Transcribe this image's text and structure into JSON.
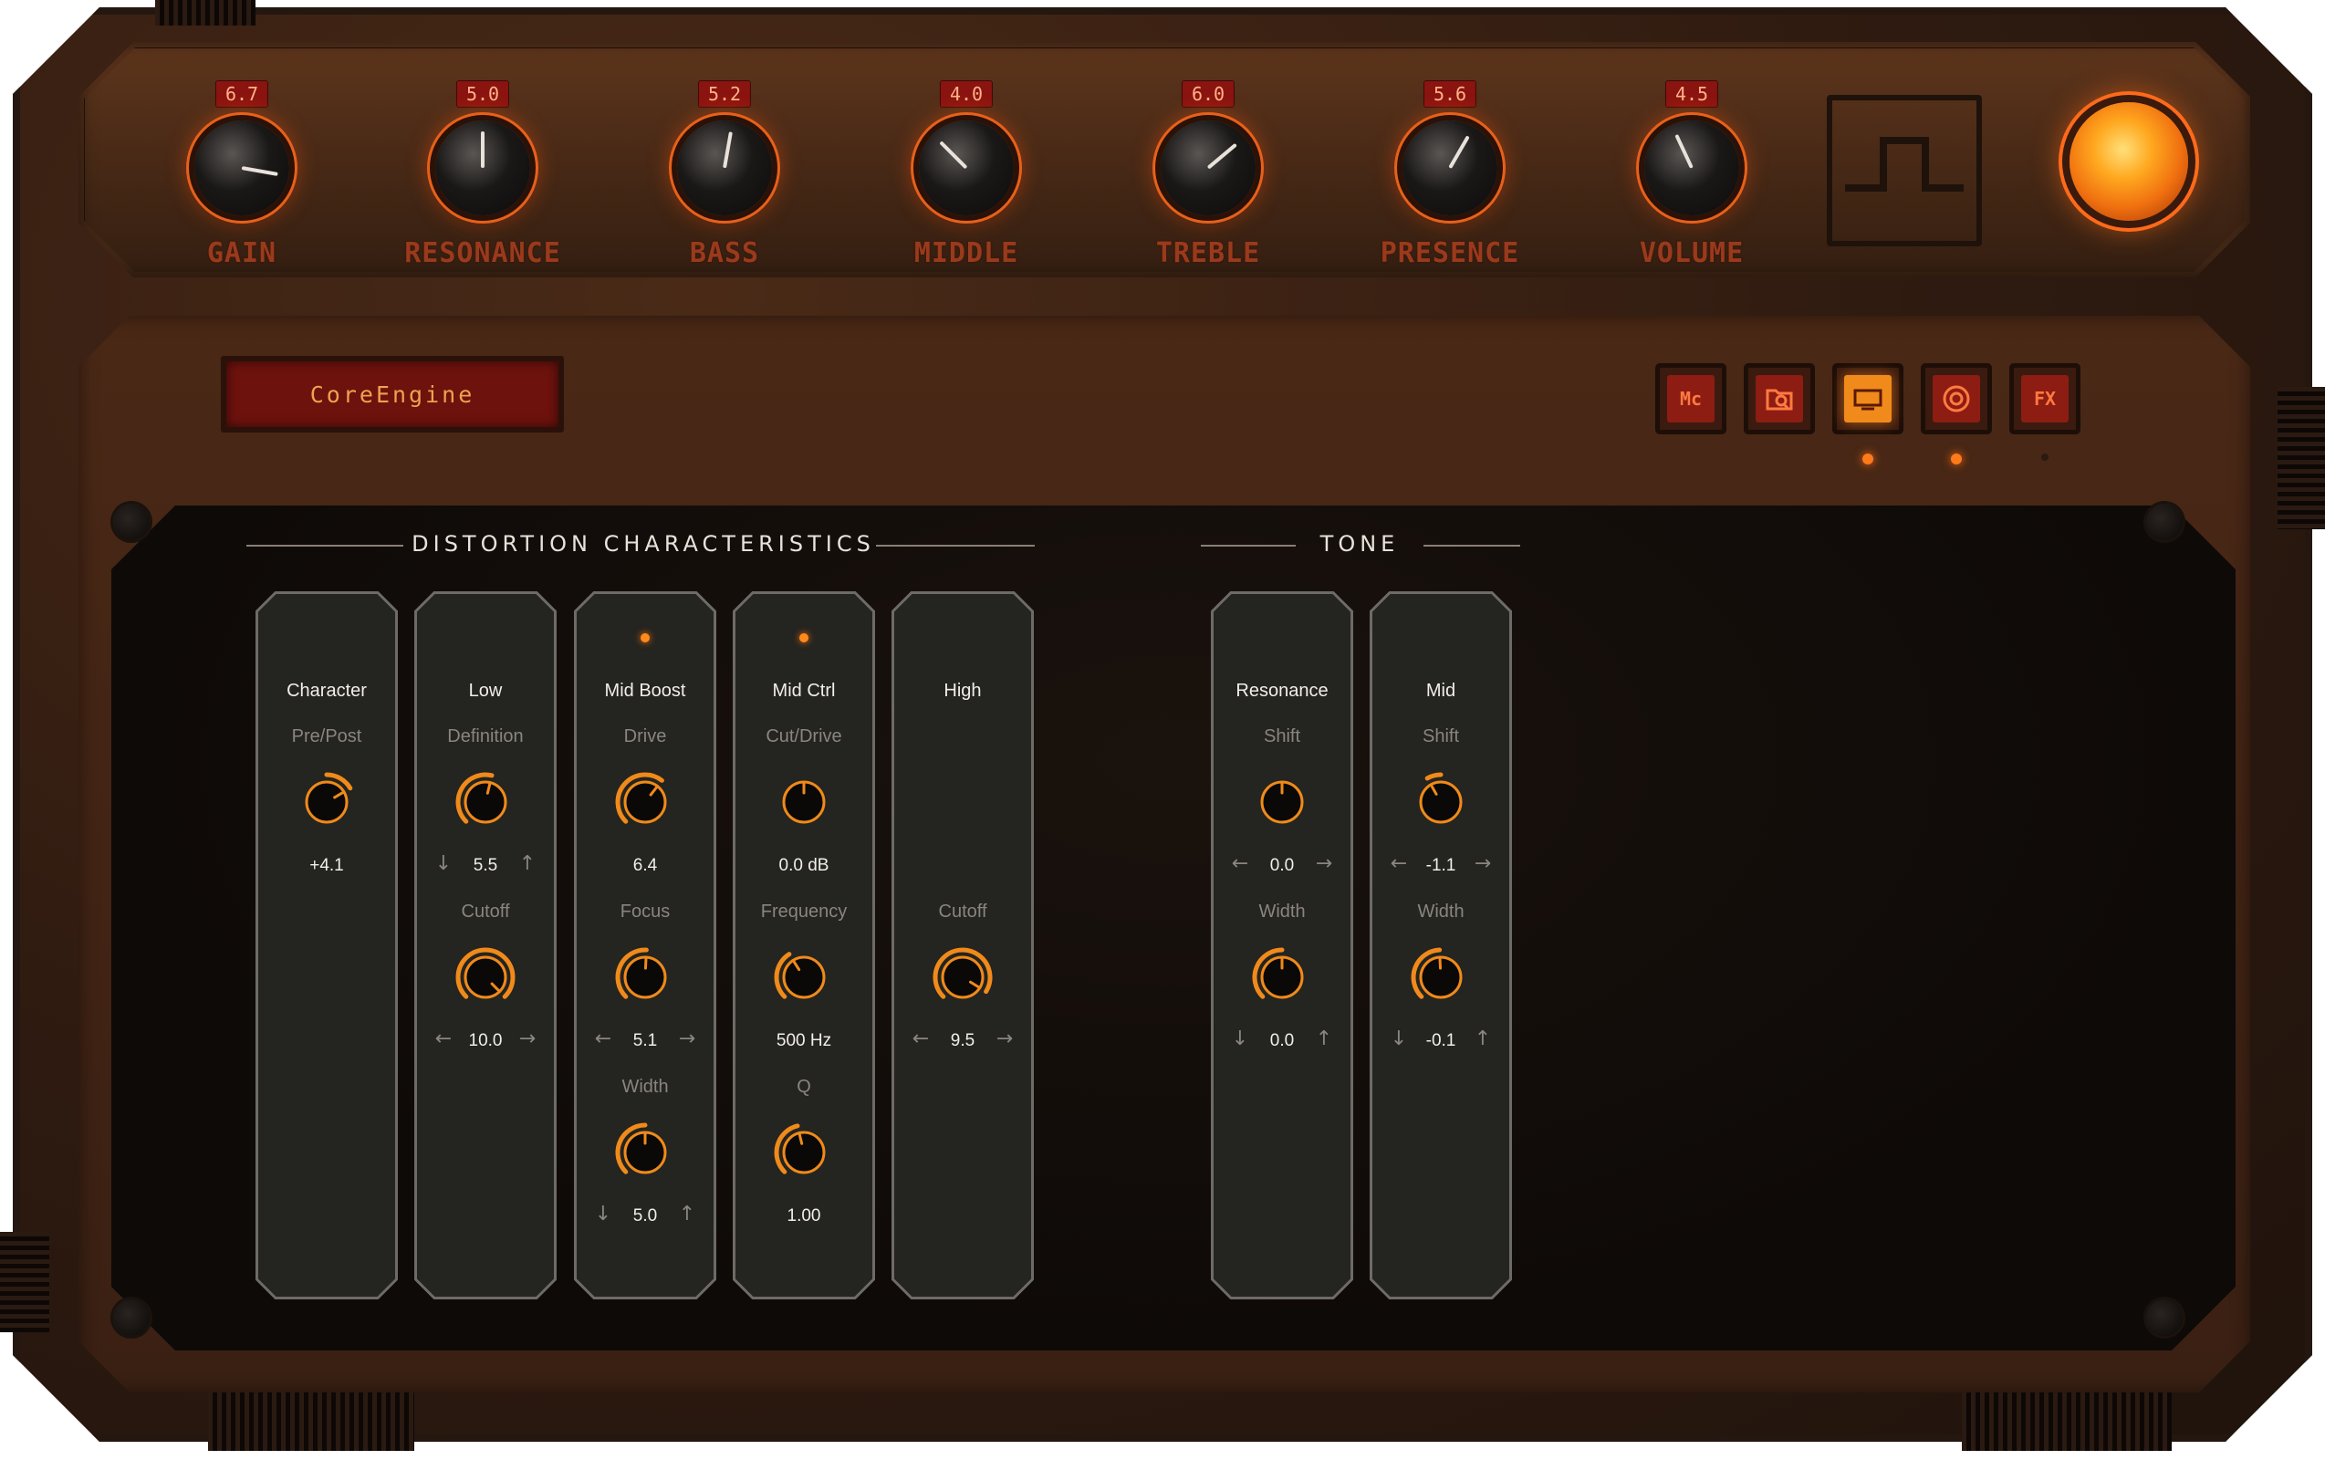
{
  "amp": {
    "knobs": [
      {
        "label": "GAIN",
        "value": "6.7",
        "angle": 100
      },
      {
        "label": "RESONANCE",
        "value": "5.0",
        "angle": 0
      },
      {
        "label": "BASS",
        "value": "5.2",
        "angle": 10
      },
      {
        "label": "MIDDLE",
        "value": "4.0",
        "angle": -45
      },
      {
        "label": "TREBLE",
        "value": "6.0",
        "angle": 50
      },
      {
        "label": "PRESENCE",
        "value": "5.6",
        "angle": 30
      },
      {
        "label": "VOLUME",
        "value": "4.5",
        "angle": -25
      }
    ]
  },
  "engine": {
    "name": "CoreEngine"
  },
  "mode_buttons": [
    {
      "label": "Mc",
      "icon": "mc-icon",
      "active": false,
      "led": "none"
    },
    {
      "label": "",
      "icon": "folder-search-icon",
      "active": false,
      "led": "none"
    },
    {
      "label": "",
      "icon": "display-icon",
      "active": true,
      "led": "on"
    },
    {
      "label": "",
      "icon": "speaker-icon",
      "active": false,
      "led": "on"
    },
    {
      "label": "FX",
      "icon": "fx-icon",
      "active": false,
      "led": "off"
    }
  ],
  "sections": {
    "distortion": "DISTORTION CHARACTERISTICS",
    "tone": "TONE"
  },
  "strips": [
    {
      "title": "Character",
      "led": false,
      "params": [
        {
          "label": "Pre/Post",
          "value": "+4.1",
          "fraction": 0.72,
          "arrows": "none"
        }
      ]
    },
    {
      "title": "Low",
      "led": false,
      "params": [
        {
          "label": "Definition",
          "value": "5.5",
          "fraction": 0.55,
          "arrows": "vertical"
        },
        {
          "label": "Cutoff",
          "value": "10.0",
          "fraction": 1.0,
          "arrows": "horizontal"
        }
      ]
    },
    {
      "title": "Mid Boost",
      "led": true,
      "params": [
        {
          "label": "Drive",
          "value": "6.4",
          "fraction": 0.64,
          "arrows": "none"
        },
        {
          "label": "Focus",
          "value": "5.1",
          "fraction": 0.51,
          "arrows": "horizontal"
        },
        {
          "label": "Width",
          "value": "5.0",
          "fraction": 0.5,
          "arrows": "vertical"
        }
      ]
    },
    {
      "title": "Mid Ctrl",
      "led": true,
      "params": [
        {
          "label": "Cut/Drive",
          "value": "0.0 dB",
          "fraction": 0.5,
          "arrows": "none"
        },
        {
          "label": "Frequency",
          "value": "500 Hz",
          "fraction": 0.38,
          "arrows": "none"
        },
        {
          "label": "Q",
          "value": "1.00",
          "fraction": 0.45,
          "arrows": "none"
        }
      ]
    },
    {
      "title": "High",
      "led": false,
      "params": [
        {
          "label": "Cutoff",
          "value": "9.5",
          "fraction": 0.95,
          "arrows": "horizontal"
        }
      ]
    },
    {
      "title": "Resonance",
      "led": false,
      "params": [
        {
          "label": "Shift",
          "value": "0.0",
          "fraction": 0.5,
          "arrows": "horizontal"
        },
        {
          "label": "Width",
          "value": "0.0",
          "fraction": 0.5,
          "arrows": "vertical"
        }
      ]
    },
    {
      "title": "Mid",
      "led": false,
      "params": [
        {
          "label": "Shift",
          "value": "-1.1",
          "fraction": 0.39,
          "arrows": "horizontal"
        },
        {
          "label": "Width",
          "value": "-0.1",
          "fraction": 0.49,
          "arrows": "vertical"
        }
      ]
    }
  ],
  "colors": {
    "accent": "#f08a1a",
    "strip_bg": "#242420",
    "strip_border": "#6e6b66",
    "knob_track": "#3a2a1c"
  }
}
